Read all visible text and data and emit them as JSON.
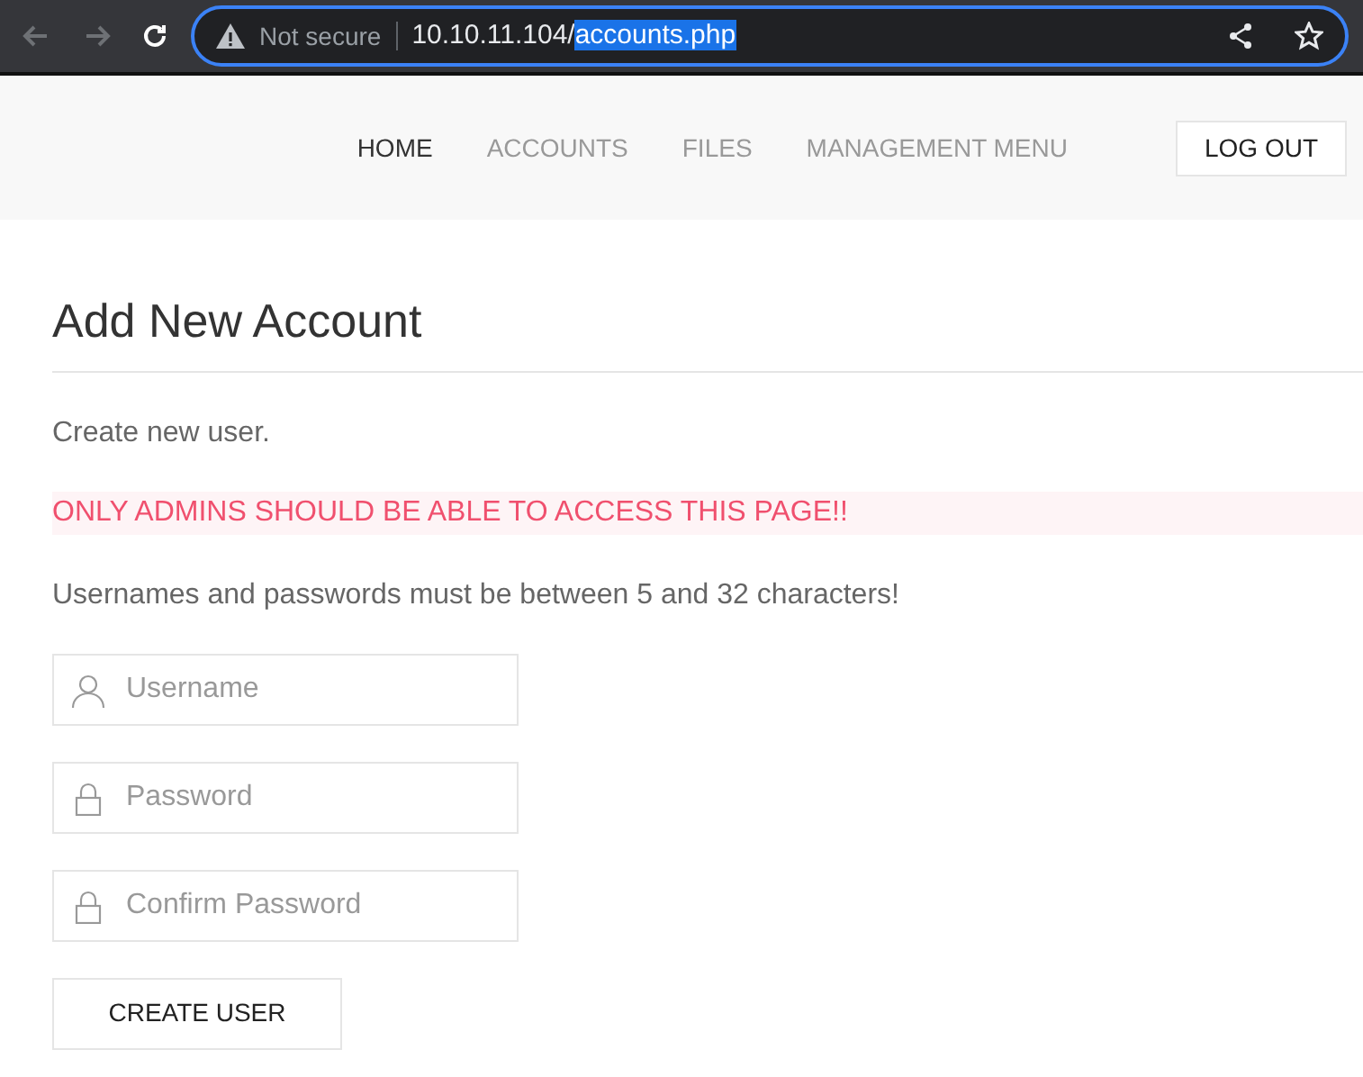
{
  "browser": {
    "back_disabled": true,
    "forward_disabled": true,
    "security": "Not secure",
    "url_host": "10.10.11.104/",
    "url_path": "accounts.php",
    "url_path_selected": true
  },
  "nav": {
    "items": [
      {
        "label": "HOME",
        "selected": true
      },
      {
        "label": "ACCOUNTS",
        "selected": false
      },
      {
        "label": "FILES",
        "selected": false
      },
      {
        "label": "MANAGEMENT MENU",
        "selected": false
      }
    ],
    "logout": "LOG OUT"
  },
  "heading": "Add New Account",
  "intro": "Create new user.",
  "warning": "ONLY ADMINS SHOULD BE ABLE TO ACCESS THIS PAGE!!",
  "rule_text": "Usernames and passwords must be between 5 and 32 characters!",
  "fields": [
    {
      "kind": "user",
      "placeholder": "Username"
    },
    {
      "kind": "lock",
      "placeholder": "Password"
    },
    {
      "kind": "lock",
      "placeholder": "Confirm Password"
    }
  ],
  "submit": "CREATE USER"
}
